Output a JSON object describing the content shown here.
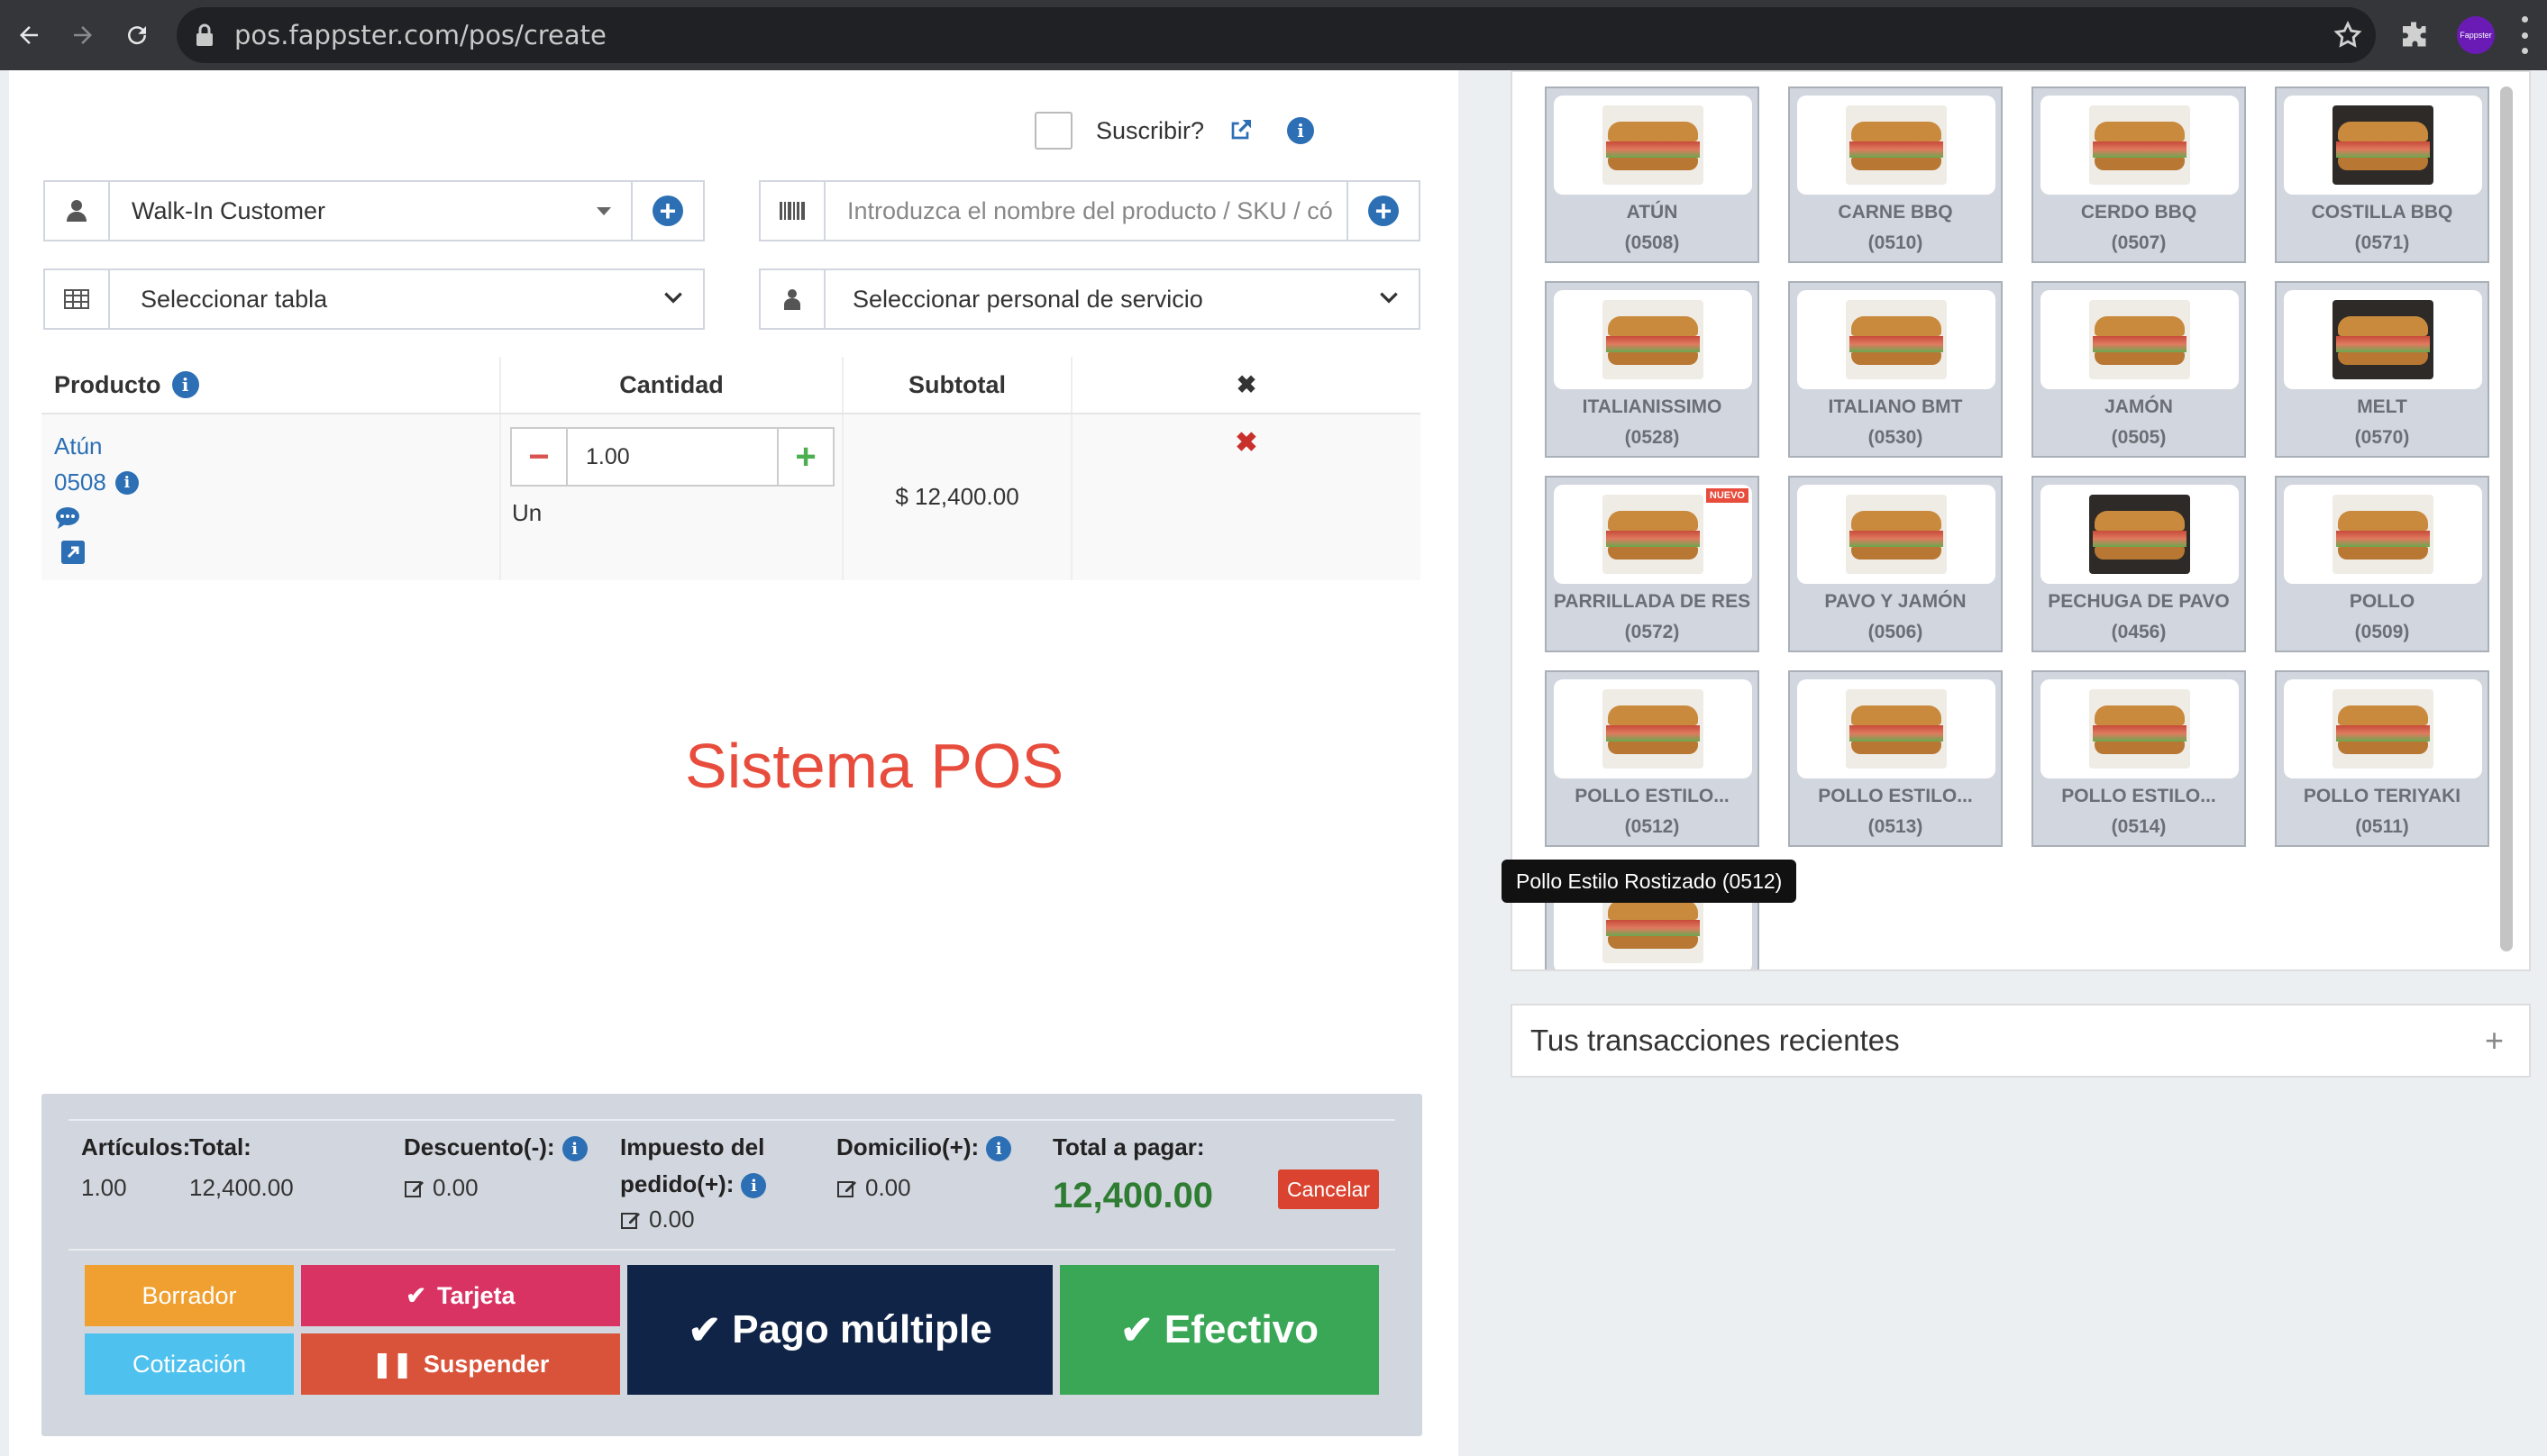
{
  "browser": {
    "url": "pos.fappster.com/pos/create",
    "profile_label": "Fappster"
  },
  "header": {
    "subscribe_label": "Suscribir?"
  },
  "customer": {
    "selected": "Walk-In Customer"
  },
  "product_search": {
    "placeholder": "Introduzca el nombre del producto / SKU / có"
  },
  "table_select": {
    "selected": "Seleccionar tabla"
  },
  "staff_select": {
    "selected": "Seleccionar personal de servicio"
  },
  "cart": {
    "headers": {
      "product": "Producto",
      "quantity": "Cantidad",
      "subtotal": "Subtotal",
      "remove": "✖"
    },
    "rows": [
      {
        "name": "Atún",
        "code": "0508",
        "quantity": "1.00",
        "unit": "Un",
        "subtotal": "$ 12,400.00"
      }
    ]
  },
  "watermark": "Sistema POS",
  "totals": {
    "items_label": "Artículos:",
    "items_value": "1.00",
    "total_label": "Total:",
    "total_value": "12,400.00",
    "discount_label": "Descuento(-):",
    "discount_value": "0.00",
    "tax_label_1": "Impuesto del",
    "tax_label_2": "pedido(+):",
    "tax_value": "0.00",
    "shipping_label": "Domicilio(+):",
    "shipping_value": "0.00",
    "payable_label": "Total a pagar:",
    "payable_value": "12,400.00",
    "cancel_label": "Cancelar"
  },
  "actions": {
    "draft": "Borrador",
    "quote": "Cotización",
    "card": "Tarjeta",
    "suspend": "Suspender",
    "multi_pay": "Pago múltiple",
    "cash": "Efectivo"
  },
  "products": [
    {
      "name": "ATÚN",
      "code": "(0508)",
      "bg": "light"
    },
    {
      "name": "CARNE BBQ",
      "code": "(0510)",
      "bg": "light"
    },
    {
      "name": "CERDO BBQ",
      "code": "(0507)",
      "bg": "light"
    },
    {
      "name": "COSTILLA BBQ",
      "code": "(0571)",
      "bg": "dark"
    },
    {
      "name": "ITALIANISSIMO",
      "code": "(0528)",
      "bg": "light"
    },
    {
      "name": "ITALIANO BMT",
      "code": "(0530)",
      "bg": "light"
    },
    {
      "name": "JAMÓN",
      "code": "(0505)",
      "bg": "light"
    },
    {
      "name": "MELT",
      "code": "(0570)",
      "bg": "dark"
    },
    {
      "name": "PARRILLADA DE RES",
      "code": "(0572)",
      "bg": "light",
      "badge": "NUEVO"
    },
    {
      "name": "PAVO Y JAMÓN",
      "code": "(0506)",
      "bg": "light"
    },
    {
      "name": "PECHUGA DE PAVO",
      "code": "(0456)",
      "bg": "dark"
    },
    {
      "name": "POLLO",
      "code": "(0509)",
      "bg": "light"
    },
    {
      "name": "POLLO ESTILO...",
      "code": "(0512)",
      "bg": "light"
    },
    {
      "name": "POLLO ESTILO...",
      "code": "(0513)",
      "bg": "light"
    },
    {
      "name": "POLLO ESTILO...",
      "code": "(0514)",
      "bg": "light"
    },
    {
      "name": "POLLO TERIYAKI",
      "code": "(0511)",
      "bg": "light"
    },
    {
      "name": "",
      "code": "",
      "bg": "light"
    }
  ],
  "tooltip": "Pollo Estilo Rostizado (0512)",
  "recent": {
    "title": "Tus transacciones recientes",
    "toggle": "+"
  },
  "colors": {
    "primary": "#2c6fb5",
    "danger": "#d9432f",
    "draft": "#f0a030",
    "quote": "#4fc1ee",
    "card": "#d93364",
    "suspend": "#d9533a",
    "multi": "#0f2447",
    "cash": "#3aa757",
    "payable": "#2e7d32"
  }
}
